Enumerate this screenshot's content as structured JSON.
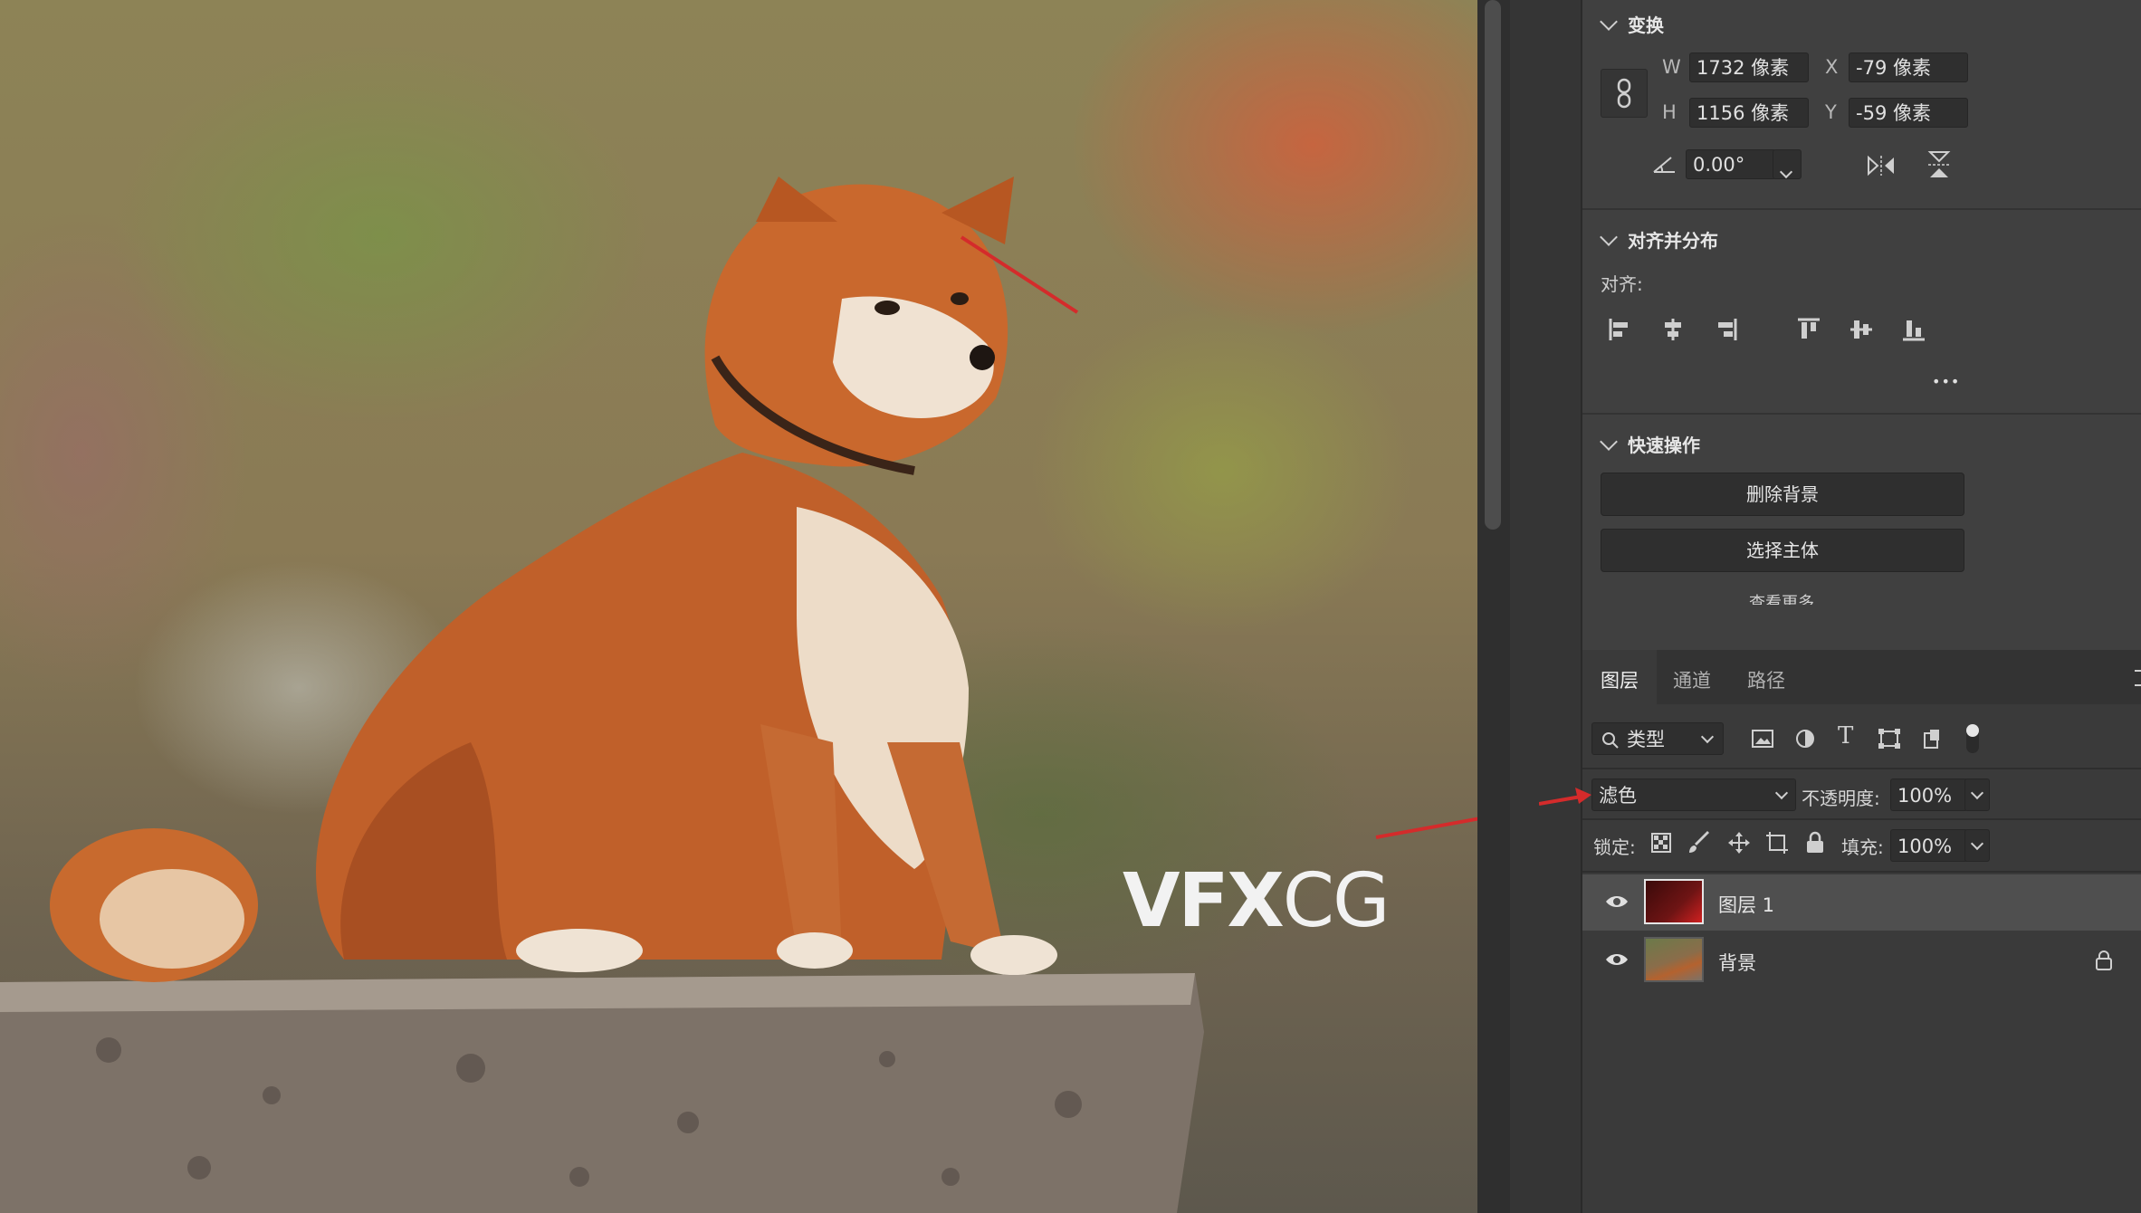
{
  "watermark": {
    "bold": "VFX",
    "thin": "CG"
  },
  "properties": {
    "transform": {
      "title": "变换",
      "w_label": "W",
      "w_value": "1732 像素",
      "x_label": "X",
      "x_value": "-79 像素",
      "h_label": "H",
      "h_value": "1156 像素",
      "y_label": "Y",
      "y_value": "-59 像素",
      "angle_value": "0.00°"
    },
    "align": {
      "title": "对齐并分布",
      "label": "对齐:",
      "more": "•••"
    },
    "quick_actions": {
      "title": "快速操作",
      "remove_bg": "删除背景",
      "select_subject": "选择主体",
      "view_more": "查看更多"
    }
  },
  "layers_panel": {
    "tabs": [
      "图层",
      "通道",
      "路径"
    ],
    "filter_label": "类型",
    "blend_mode": "滤色",
    "opacity_label": "不透明度:",
    "opacity_value": "100%",
    "lock_label": "锁定:",
    "fill_label": "填充:",
    "fill_value": "100%",
    "layers": [
      {
        "name": "图层 1",
        "selected": true
      },
      {
        "name": "背景",
        "locked": true
      }
    ]
  },
  "colors": {
    "accent_red": "#d42b2b",
    "panel_bg": "#404040",
    "field_bg": "#2f2f2f"
  }
}
